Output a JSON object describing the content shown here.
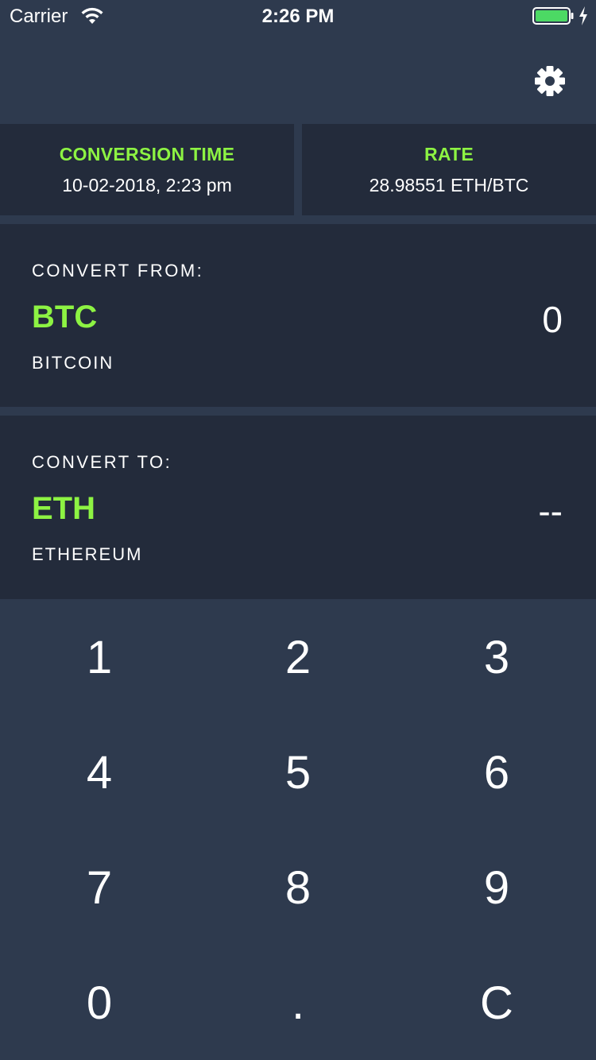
{
  "status_bar": {
    "carrier": "Carrier",
    "time": "2:26 PM",
    "wifi_icon": "wifi-icon",
    "battery_icon": "battery-icon",
    "battery_color": "#4cd964"
  },
  "header": {
    "settings_icon": "gear-icon"
  },
  "info": {
    "conversion_time_label": "CONVERSION TIME",
    "conversion_time_value": "10-02-2018, 2:23 pm",
    "rate_label": "RATE",
    "rate_value": "28.98551 ETH/BTC"
  },
  "convert_from": {
    "label": "CONVERT FROM:",
    "code": "BTC",
    "name": "BITCOIN",
    "amount": "0"
  },
  "convert_to": {
    "label": "CONVERT TO:",
    "code": "ETH",
    "name": "ETHEREUM",
    "amount": "--"
  },
  "keypad": {
    "keys": [
      "1",
      "2",
      "3",
      "4",
      "5",
      "6",
      "7",
      "8",
      "9",
      "0",
      ".",
      "C"
    ]
  },
  "colors": {
    "background": "#2e3a4e",
    "card": "#232b3b",
    "accent": "#8df343",
    "text": "#ffffff"
  }
}
